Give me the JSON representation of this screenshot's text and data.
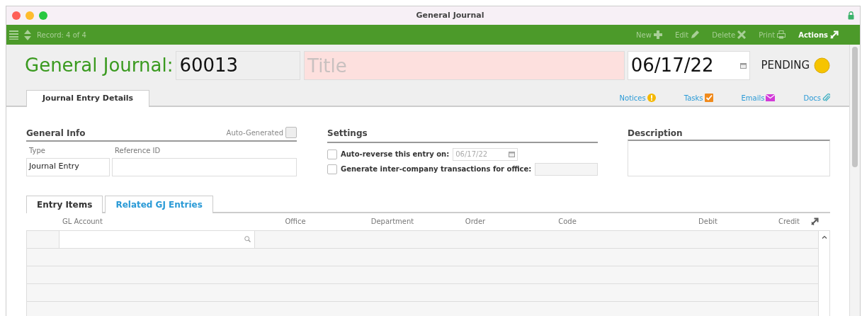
{
  "window": {
    "title": "General Journal"
  },
  "toolbar": {
    "record": "Record: 4 of 4",
    "actions": [
      {
        "label": "New",
        "kind": "new",
        "disabled": true
      },
      {
        "label": "Edit",
        "kind": "edit",
        "disabled": true
      },
      {
        "label": "Delete",
        "kind": "delete",
        "disabled": true
      },
      {
        "label": "Print",
        "kind": "print",
        "disabled": true
      },
      {
        "label": "Actions",
        "kind": "actions",
        "disabled": false
      }
    ]
  },
  "header": {
    "label": "General Journal:",
    "number": "60013",
    "title_placeholder": "Title",
    "date": "06/17/22",
    "status": "PENDING"
  },
  "tabs": [
    {
      "label": "Journal Entry Details",
      "selected": true
    }
  ],
  "links": [
    {
      "label": "Notices",
      "kind": "notices"
    },
    {
      "label": "Tasks",
      "kind": "tasks"
    },
    {
      "label": "Emails",
      "kind": "emails"
    },
    {
      "label": "Docs",
      "kind": "docs"
    }
  ],
  "general_info": {
    "heading": "General Info",
    "auto_generated": {
      "label": "Auto-Generated",
      "checked": false
    },
    "fields": [
      {
        "label": "Type",
        "value": "Journal Entry"
      },
      {
        "label": "Reference ID"
      }
    ]
  },
  "settings": {
    "heading": "Settings",
    "options": [
      {
        "label": "Auto-reverse this entry on:",
        "checked": false,
        "kind": "date",
        "value": "06/17/22"
      },
      {
        "label": "Generate inter-company transactions for office:",
        "checked": false,
        "kind": "text"
      }
    ]
  },
  "description": {
    "heading": "Description"
  },
  "sub_tabs": [
    {
      "label": "Entry Items",
      "selected": true
    },
    {
      "label": "Related GJ Entries",
      "selected": false
    }
  ],
  "table": {
    "columns": [
      "GL Account",
      "Office",
      "Department",
      "Order",
      "Code",
      "Debit",
      "Credit"
    ]
  }
}
